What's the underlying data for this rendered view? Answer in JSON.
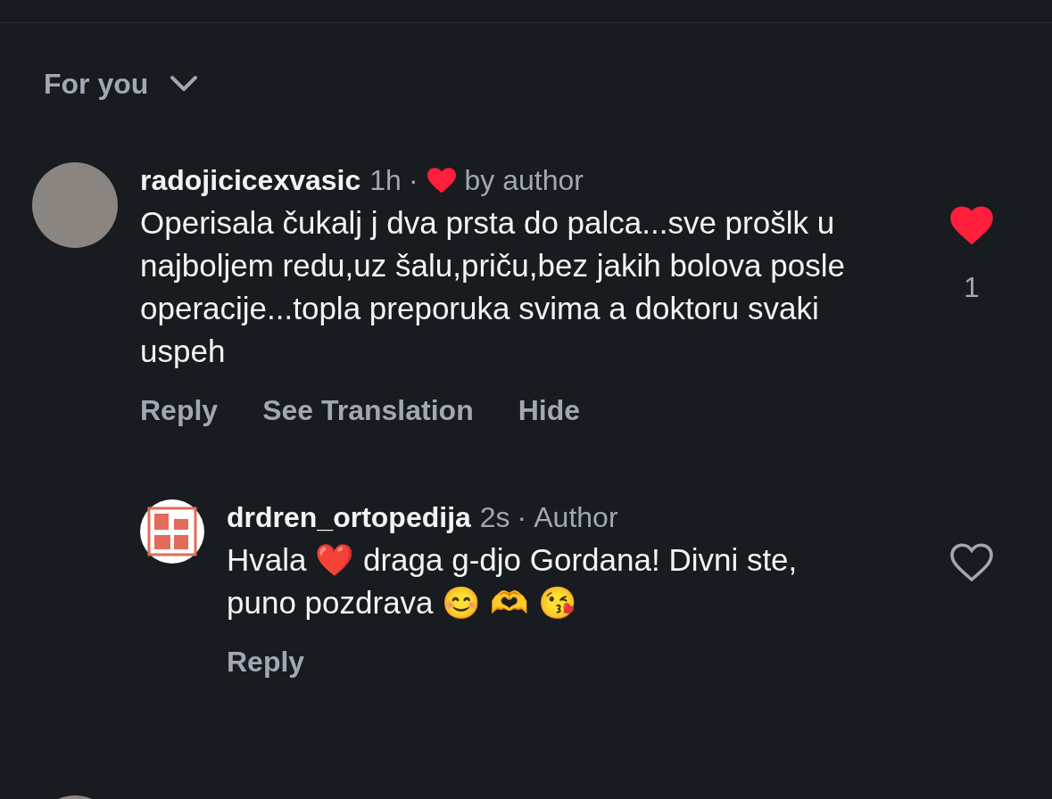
{
  "sort": {
    "label": "For you"
  },
  "comments": [
    {
      "kind": "comment",
      "username": "radojicicexvasic",
      "time": "1h",
      "separator": "·",
      "liked_by_author": true,
      "author_label": "by author",
      "text": "Operisala čukalj j dva prsta do palca...sve prošlk u najboljem redu,uz šalu,priču,bez jakih bolova posle operacije...topla preporuka svima a doktoru svaki uspeh",
      "actions": [
        "Reply",
        "See Translation",
        "Hide"
      ],
      "liked": true,
      "like_count": "1"
    },
    {
      "kind": "reply",
      "username": "drdren_ortopedija",
      "time": "2s",
      "separator": "·",
      "liked_by_author": false,
      "author_label": "Author",
      "text": "Hvala ❤️ draga g-djo Gordana! Divni ste, puno pozdrava 😊 🫶 😘",
      "actions": [
        "Reply"
      ],
      "liked": false
    }
  ]
}
